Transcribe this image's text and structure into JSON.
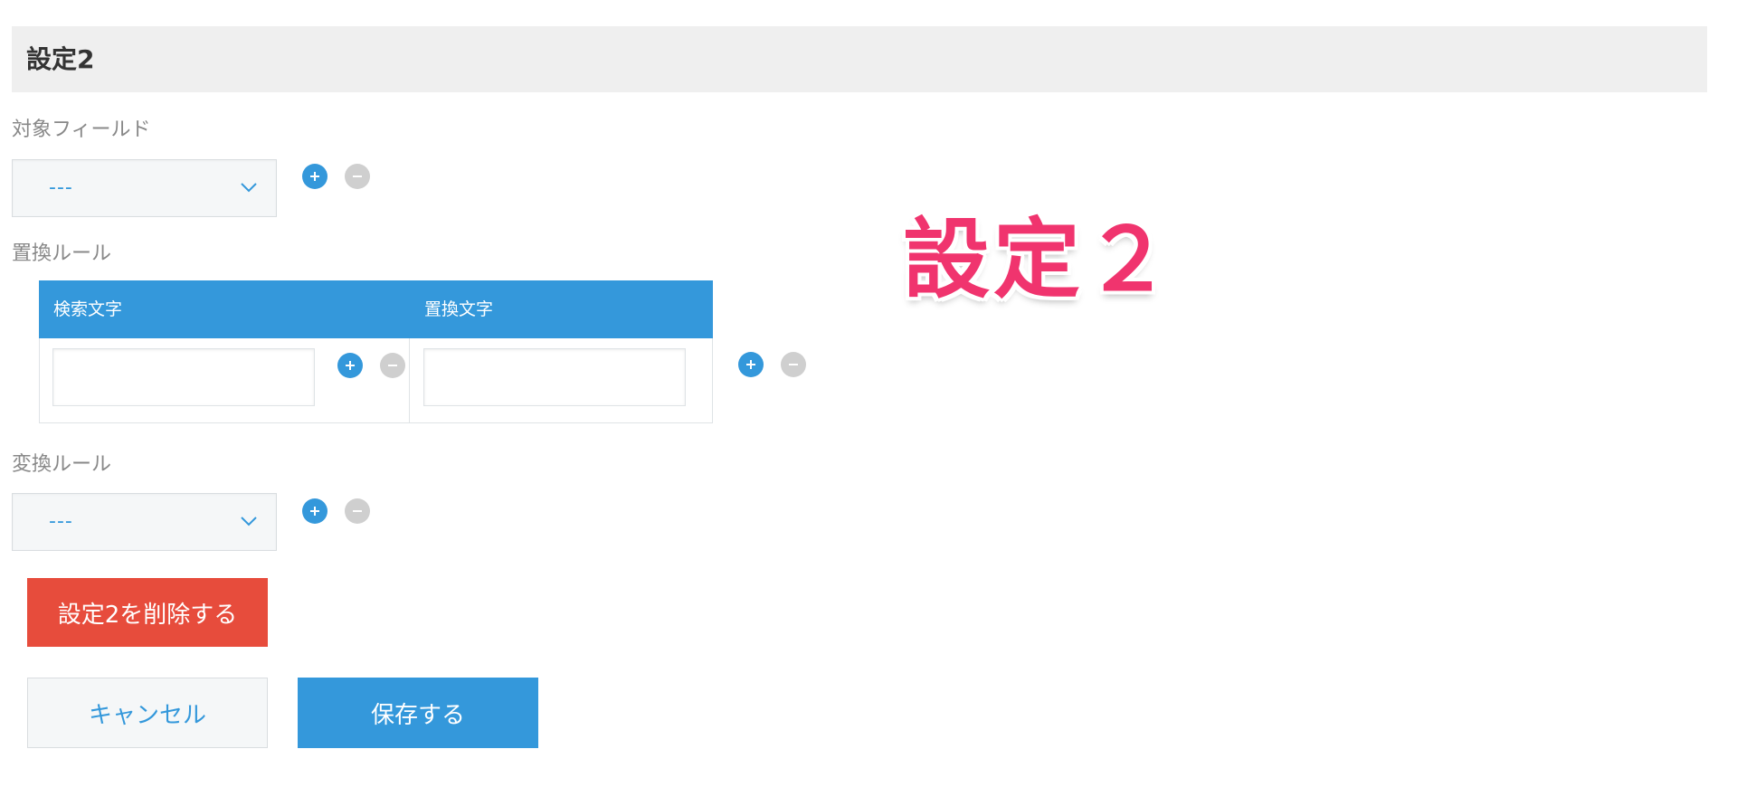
{
  "section": {
    "title": "設定2"
  },
  "target_field": {
    "label": "対象フィールド",
    "selected": "---",
    "add_icon": "plus-icon",
    "remove_icon": "minus-icon"
  },
  "replace_rule": {
    "label": "置換ルール",
    "columns": [
      "検索文字",
      "置換文字"
    ],
    "search_value": "",
    "replace_value": ""
  },
  "convert_rule": {
    "label": "変換ルール",
    "selected": "---"
  },
  "overlay": {
    "text": "設定２"
  },
  "buttons": {
    "delete_label": "設定2を削除する",
    "cancel_label": "キャンセル",
    "save_label": "保存する"
  },
  "colors": {
    "accent": "#3498db",
    "danger": "#e74c3c",
    "overlay": "#f0346e",
    "header_bg": "#efefef"
  }
}
